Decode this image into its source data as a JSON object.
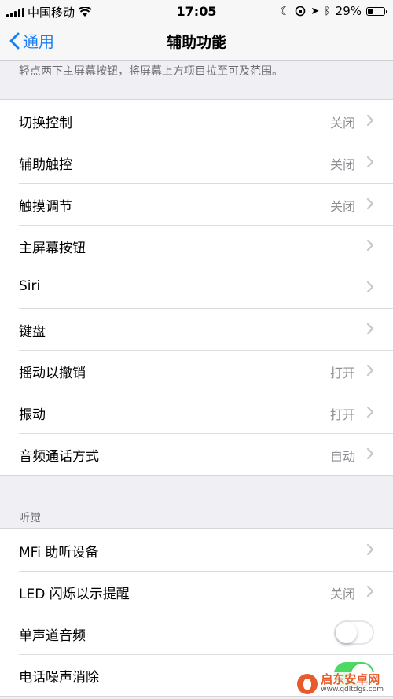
{
  "status_bar": {
    "carrier": "中国移动",
    "time": "17:05",
    "battery_percent_label": "29%",
    "battery_level": 0.29
  },
  "nav": {
    "back_label": "通用",
    "title": "辅助功能"
  },
  "hint_text": "轻点两下主屏幕按钮，将屏幕上方项目拉至可及范围。",
  "interaction_rows": [
    {
      "label": "切换控制",
      "value": "关闭"
    },
    {
      "label": "辅助触控",
      "value": "关闭"
    },
    {
      "label": "触摸调节",
      "value": "关闭"
    },
    {
      "label": "主屏幕按钮",
      "value": ""
    },
    {
      "label": "Siri",
      "value": ""
    },
    {
      "label": "键盘",
      "value": ""
    },
    {
      "label": "摇动以撤销",
      "value": "打开"
    },
    {
      "label": "振动",
      "value": "打开"
    },
    {
      "label": "音频通话方式",
      "value": "自动"
    }
  ],
  "hearing_header": "听觉",
  "hearing_rows": [
    {
      "label": "MFi 助听设备",
      "value": ""
    },
    {
      "label": "LED 闪烁以示提醒",
      "value": "关闭"
    },
    {
      "label": "单声道音频",
      "toggle": false
    },
    {
      "label": "电话噪声消除",
      "toggle": true
    }
  ],
  "watermark": {
    "title": "启东安卓网",
    "url": "www.qdltdgs.com"
  },
  "colors": {
    "accent": "#1a7ef5",
    "toggle_on": "#4cd964",
    "background": "#efeff4",
    "secondary_text": "#8e8e93"
  }
}
